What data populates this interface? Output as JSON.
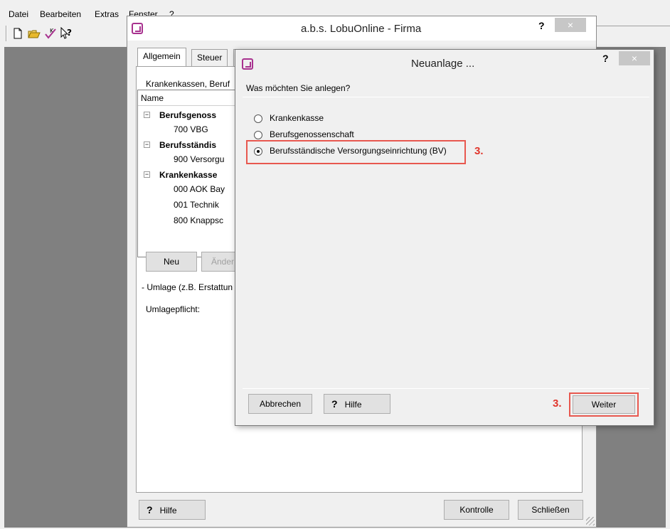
{
  "menubar": {
    "items": [
      "Datei",
      "Bearbeiten",
      "Extras",
      "Fenster",
      "?"
    ]
  },
  "toolbar": {
    "icons": [
      "new-document-icon",
      "open-folder-icon",
      "check-k-icon",
      "whats-this-help-icon"
    ]
  },
  "firma_window": {
    "title": "a.b.s. LobuOnline - Firma",
    "help_label": "?",
    "close_label": "×",
    "tabs": [
      "Allgemein",
      "Steuer",
      ""
    ],
    "list_label": "Krankenkassen, Beruf",
    "tree_header": "Name",
    "tree": [
      {
        "label": "Berufsgenoss",
        "bold": true,
        "children": [
          "700 VBG"
        ]
      },
      {
        "label": "Berufsständis",
        "bold": true,
        "children": [
          "900 Versorgu"
        ]
      },
      {
        "label": "Krankenkasse",
        "bold": true,
        "children": [
          "000 AOK Bay",
          "001 Technik",
          "800 Knappsc"
        ]
      }
    ],
    "neu_button": "Neu",
    "aendern_button": "Änder",
    "umlage_label": "- Umlage (z.B. Erstattun",
    "umlagepflicht_label": "Umlagepflicht:",
    "hilfe_button": "Hilfe",
    "hilfe_q": "?",
    "kontrolle_button": "Kontrolle",
    "schliessen_button": "Schließen"
  },
  "neuanlage_dialog": {
    "title": "Neuanlage ...",
    "help_label": "?",
    "close_label": "×",
    "question": "Was möchten Sie anlegen?",
    "options": [
      {
        "label": "Krankenkasse",
        "checked": false
      },
      {
        "label": "Berufsgenossenschaft",
        "checked": false
      },
      {
        "label": "Berufsständische Versorgungseinrichtung (BV)",
        "checked": true
      }
    ],
    "annotation_option": "3.",
    "abbrechen_button": "Abbrechen",
    "hilfe_button": "Hilfe",
    "hilfe_q": "?",
    "annotation_weiter": "3.",
    "weiter_button": "Weiter"
  },
  "colors": {
    "highlight": "#e8584f",
    "annotation": "#e0352b",
    "app_icon": "#a8328f",
    "mdi_background": "#808080"
  }
}
